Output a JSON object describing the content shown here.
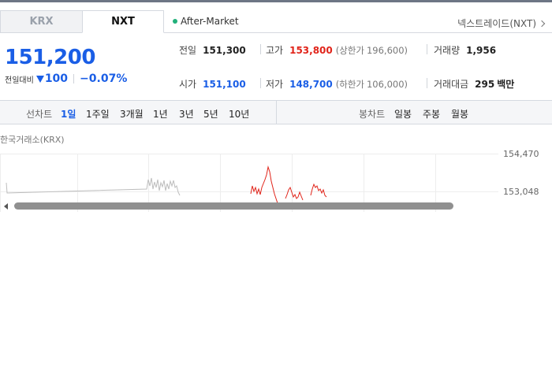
{
  "tabs": [
    {
      "label": "KRX",
      "active": false
    },
    {
      "label": "NXT",
      "active": true
    }
  ],
  "session_status": "After-Market",
  "nxt_link": "넥스트레이드(NXT)",
  "price": {
    "current": "151,200",
    "change_label": "전일대비",
    "change": "100",
    "change_pct": "−0.07%",
    "direction": "down",
    "down_color": "#1a5ee6",
    "up_color": "#e1241a"
  },
  "stats": {
    "prev_close_label": "전일",
    "prev_close": "151,300",
    "high_label": "고가",
    "high": "153,800",
    "upper_limit_label": "(상한가",
    "upper_limit": "196,600)",
    "volume_label": "거래량",
    "volume": "1,956",
    "open_label": "시가",
    "open": "151,100",
    "low_label": "저가",
    "low": "148,700",
    "lower_limit_label": "(하한가",
    "lower_limit": "106,000)",
    "amount_label": "거래대금",
    "amount": "295",
    "amount_unit": "백만"
  },
  "toolbar": {
    "line_chart_label": "선차트",
    "periods": [
      "1일",
      "1주일",
      "3개월",
      "1년",
      "3년",
      "5년",
      "10년"
    ],
    "active_period": "1일",
    "candle_chart_label": "봉차트",
    "candle_periods": [
      "일봉",
      "주봉",
      "월봉"
    ]
  },
  "market_label": "한국거래소(KRX)",
  "chart_data": {
    "type": "line",
    "y_ticks": [
      "154,470",
      "153,048"
    ],
    "ylim": [
      153048,
      154470
    ],
    "grid": true,
    "series": [
      {
        "color": "#bdbdbd",
        "points": [
          [
            8,
            232
          ],
          [
            9,
            245
          ],
          [
            186,
            240
          ],
          [
            188,
            228
          ],
          [
            190,
            236
          ],
          [
            192,
            226
          ],
          [
            194,
            240
          ],
          [
            196,
            231
          ],
          [
            198,
            238
          ],
          [
            200,
            228
          ],
          [
            202,
            242
          ],
          [
            204,
            232
          ],
          [
            206,
            237
          ],
          [
            208,
            229
          ],
          [
            210,
            242
          ],
          [
            212,
            233
          ],
          [
            214,
            240
          ],
          [
            216,
            230
          ],
          [
            218,
            236
          ],
          [
            220,
            229
          ],
          [
            222,
            238
          ],
          [
            224,
            236
          ],
          [
            226,
            244
          ],
          [
            228,
            248
          ]
        ]
      },
      {
        "color": "#e1241a",
        "points": [
          [
            318,
            246
          ],
          [
            320,
            236
          ],
          [
            322,
            243
          ],
          [
            324,
            238
          ],
          [
            326,
            246
          ],
          [
            328,
            240
          ],
          [
            330,
            247
          ],
          [
            332,
            238
          ],
          [
            334,
            233
          ],
          [
            336,
            228
          ],
          [
            338,
            222
          ],
          [
            340,
            212
          ],
          [
            342,
            218
          ],
          [
            344,
            230
          ],
          [
            346,
            238
          ],
          [
            348,
            246
          ],
          [
            350,
            252
          ],
          [
            352,
            258
          ]
        ]
      },
      {
        "color": "#e1241a",
        "points": [
          [
            362,
            252
          ],
          [
            364,
            247
          ],
          [
            366,
            241
          ],
          [
            368,
            238
          ],
          [
            370,
            244
          ],
          [
            372,
            250
          ],
          [
            374,
            247
          ],
          [
            376,
            252
          ],
          [
            378,
            250
          ],
          [
            380,
            244
          ],
          [
            382,
            249
          ],
          [
            384,
            254
          ]
        ]
      },
      {
        "color": "#e1241a",
        "points": [
          [
            394,
            248
          ],
          [
            396,
            240
          ],
          [
            398,
            234
          ],
          [
            400,
            238
          ],
          [
            402,
            236
          ],
          [
            404,
            242
          ],
          [
            406,
            240
          ],
          [
            408,
            245
          ],
          [
            410,
            241
          ],
          [
            412,
            248
          ],
          [
            414,
            250
          ]
        ]
      }
    ]
  },
  "colors": {
    "accent": "#1a5ee6",
    "up": "#e1241a",
    "live_dot": "#21b07a"
  }
}
